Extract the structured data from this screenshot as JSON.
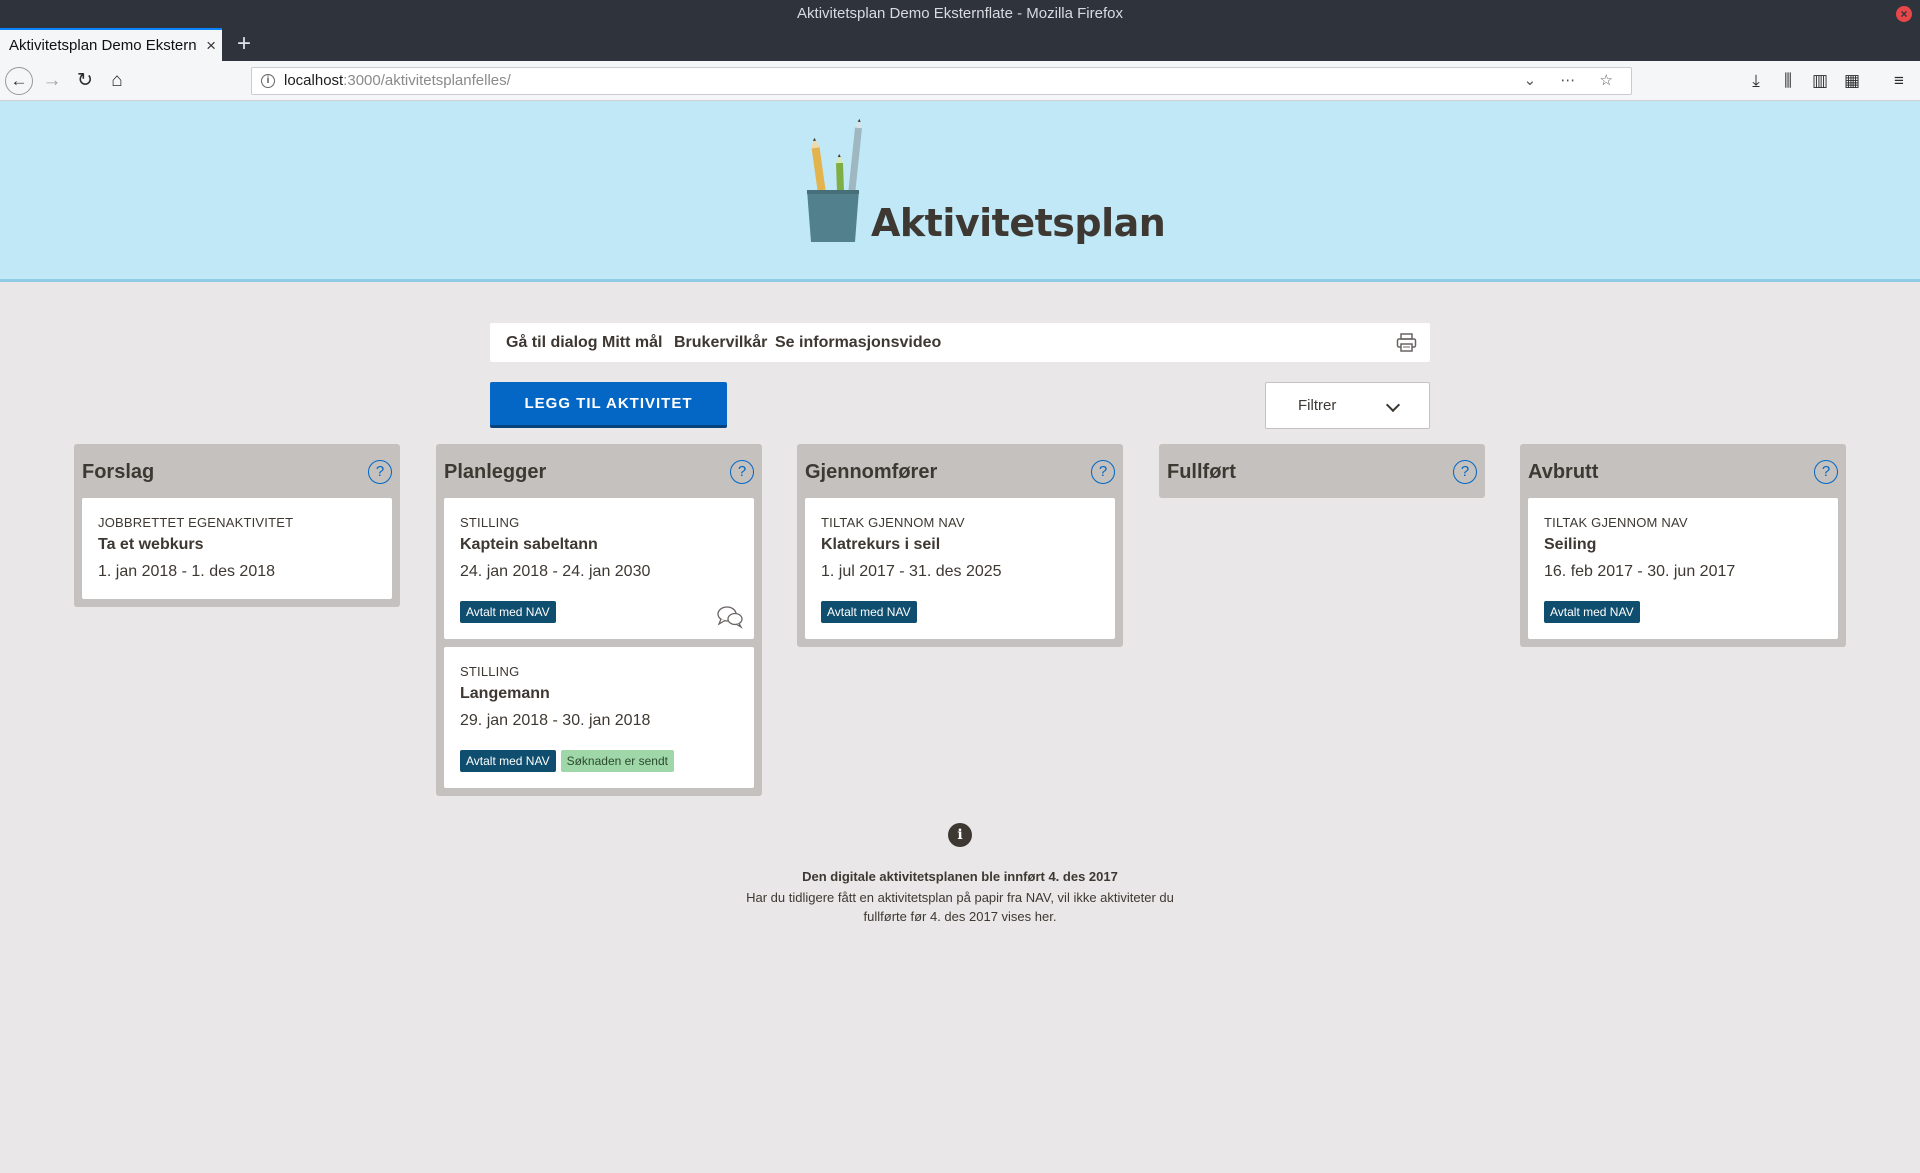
{
  "window": {
    "title": "Aktivitetsplan Demo Eksternflate - Mozilla Firefox"
  },
  "browser": {
    "tab_title": "Aktivitetsplan Demo Eksternflate - Mozilla Firefox",
    "url_host": "localhost",
    "url_rest": ":3000/aktivitetsplanfelles/"
  },
  "header": {
    "title": "Aktivitetsplan"
  },
  "menu": {
    "items": [
      "Gå til dialog",
      "Mitt mål",
      "Brukervilkår",
      "Se informasjonsvideo"
    ]
  },
  "actions": {
    "add_label": "LEGG TIL AKTIVITET",
    "filter_label": "Filtrer"
  },
  "columns": [
    {
      "title": "Forslag",
      "cards": [
        {
          "type": "JOBBRETTET EGENAKTIVITET",
          "title": "Ta et webkurs",
          "dates": "1. jan 2018 - 1. des 2018",
          "badges": []
        }
      ]
    },
    {
      "title": "Planlegger",
      "cards": [
        {
          "type": "STILLING",
          "title": "Kaptein sabeltann",
          "dates": "24. jan 2018 - 24. jan 2030",
          "badges": [
            "Avtalt med NAV"
          ]
        },
        {
          "type": "STILLING",
          "title": "Langemann",
          "dates": "29. jan 2018 - 30. jan 2018",
          "badges": [
            "Avtalt med NAV",
            "Søknaden er sendt"
          ]
        }
      ]
    },
    {
      "title": "Gjennomfører",
      "cards": [
        {
          "type": "TILTAK GJENNOM NAV",
          "title": "Klatrekurs i seil",
          "dates": "1. jul 2017 - 31. des 2025",
          "badges": [
            "Avtalt med NAV"
          ]
        }
      ]
    },
    {
      "title": "Fullført",
      "cards": []
    },
    {
      "title": "Avbrutt",
      "cards": [
        {
          "type": "TILTAK GJENNOM NAV",
          "title": "Seiling",
          "dates": "16. feb 2017 - 30. jun 2017",
          "badges": [
            "Avtalt med NAV"
          ]
        }
      ]
    }
  ],
  "info": {
    "heading": "Den digitale aktivitetsplanen ble innført 4. des 2017",
    "text": "Har du tidligere fått en aktivitetsplan på papir fra NAV, vil ikke aktiviteter du fullførte før 4. des 2017 vises her."
  },
  "colors": {
    "header_bg": "#c1e8f6",
    "page_bg": "#e9e7e7",
    "primary_button": "#0567c5",
    "badge_avtalt": "#0f4e6e",
    "badge_sendt": "#a0d7a8"
  },
  "icons": {
    "back": "back-arrow-icon",
    "forward": "forward-arrow-icon",
    "reload": "reload-icon",
    "home": "home-icon",
    "print": "printer-icon",
    "help": "help-icon",
    "dialog": "speech-bubbles-icon",
    "info": "info-icon"
  }
}
